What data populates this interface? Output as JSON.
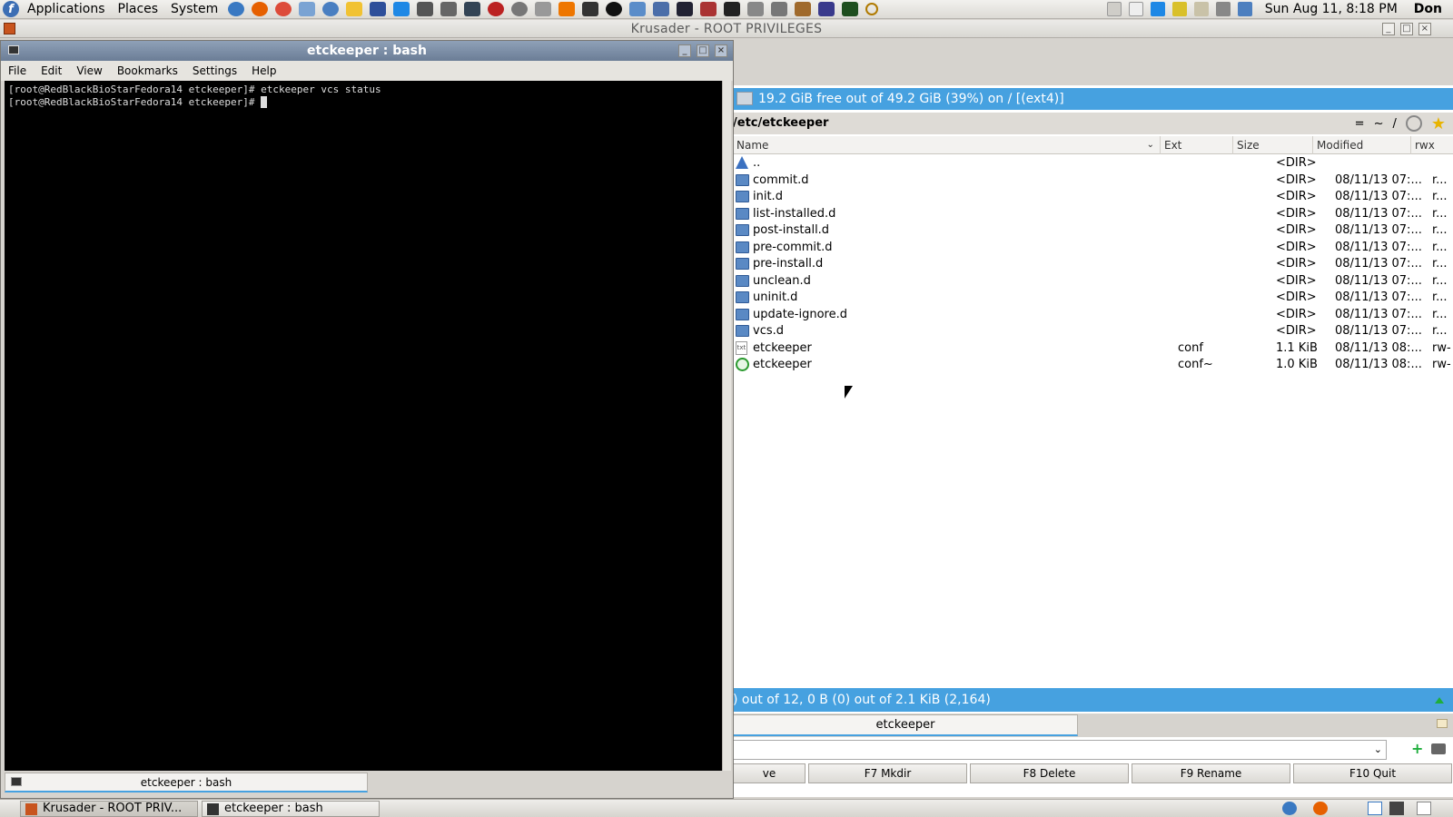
{
  "top_panel": {
    "menus": [
      "Applications",
      "Places",
      "System"
    ],
    "clock": "Sun Aug 11,  8:18 PM",
    "user": "Don"
  },
  "krusader": {
    "window_title": "Krusader - ROOT PRIVILEGES",
    "disk_info": "19.2 GiB free out of 49.2 GiB (39%) on / [(ext4)]",
    "path": "/etc/etckeeper",
    "path_tools": [
      "=",
      "~",
      "/"
    ],
    "columns": [
      "Name",
      "Ext",
      "Size",
      "Modified",
      "rwx"
    ],
    "rows": [
      {
        "name": "..",
        "ext": "",
        "size": "<DIR>",
        "modified": "",
        "rwx": "",
        "icon": "up-arrow-icon"
      },
      {
        "name": "commit.d",
        "ext": "",
        "size": "<DIR>",
        "modified": "08/11/13 07:...",
        "rwx": "r...",
        "icon": "folder-icon"
      },
      {
        "name": "init.d",
        "ext": "",
        "size": "<DIR>",
        "modified": "08/11/13 07:...",
        "rwx": "r...",
        "icon": "folder-icon"
      },
      {
        "name": "list-installed.d",
        "ext": "",
        "size": "<DIR>",
        "modified": "08/11/13 07:...",
        "rwx": "r...",
        "icon": "folder-icon"
      },
      {
        "name": "post-install.d",
        "ext": "",
        "size": "<DIR>",
        "modified": "08/11/13 07:...",
        "rwx": "r...",
        "icon": "folder-icon"
      },
      {
        "name": "pre-commit.d",
        "ext": "",
        "size": "<DIR>",
        "modified": "08/11/13 07:...",
        "rwx": "r...",
        "icon": "folder-icon"
      },
      {
        "name": "pre-install.d",
        "ext": "",
        "size": "<DIR>",
        "modified": "08/11/13 07:...",
        "rwx": "r...",
        "icon": "folder-icon"
      },
      {
        "name": "unclean.d",
        "ext": "",
        "size": "<DIR>",
        "modified": "08/11/13 07:...",
        "rwx": "r...",
        "icon": "folder-icon"
      },
      {
        "name": "uninit.d",
        "ext": "",
        "size": "<DIR>",
        "modified": "08/11/13 07:...",
        "rwx": "r...",
        "icon": "folder-icon"
      },
      {
        "name": "update-ignore.d",
        "ext": "",
        "size": "<DIR>",
        "modified": "08/11/13 07:...",
        "rwx": "r...",
        "icon": "folder-icon"
      },
      {
        "name": "vcs.d",
        "ext": "",
        "size": "<DIR>",
        "modified": "08/11/13 07:...",
        "rwx": "r...",
        "icon": "folder-icon"
      },
      {
        "name": "etckeeper",
        "ext": "conf",
        "size": "1.1 KiB",
        "modified": "08/11/13 08:...",
        "rwx": "rw-",
        "icon": "text-file-icon"
      },
      {
        "name": "etckeeper",
        "ext": "conf~",
        "size": "1.0 KiB",
        "modified": "08/11/13 08:...",
        "rwx": "rw-",
        "icon": "backup-file-icon"
      }
    ],
    "status": ") out of 12, 0 B (0) out of 2.1 KiB (2,164)",
    "tab_label": "etckeeper",
    "fkeys": [
      "ve",
      "F7 Mkdir",
      "F8 Delete",
      "F9 Rename",
      "F10 Quit"
    ]
  },
  "terminal": {
    "title": "etckeeper : bash",
    "menus": [
      "File",
      "Edit",
      "View",
      "Bookmarks",
      "Settings",
      "Help"
    ],
    "lines": [
      "[root@RedBlackBioStarFedora14 etckeeper]# etckeeper vcs status",
      "[root@RedBlackBioStarFedora14 etckeeper]# "
    ],
    "tab_label": "etckeeper : bash"
  },
  "taskbar": {
    "tasks": [
      "Krusader - ROOT PRIV...",
      "etckeeper : bash"
    ]
  },
  "colors": {
    "accent_blue": "#46a1e0",
    "terminal_bg": "#000000",
    "folder": "#5a89c4"
  }
}
